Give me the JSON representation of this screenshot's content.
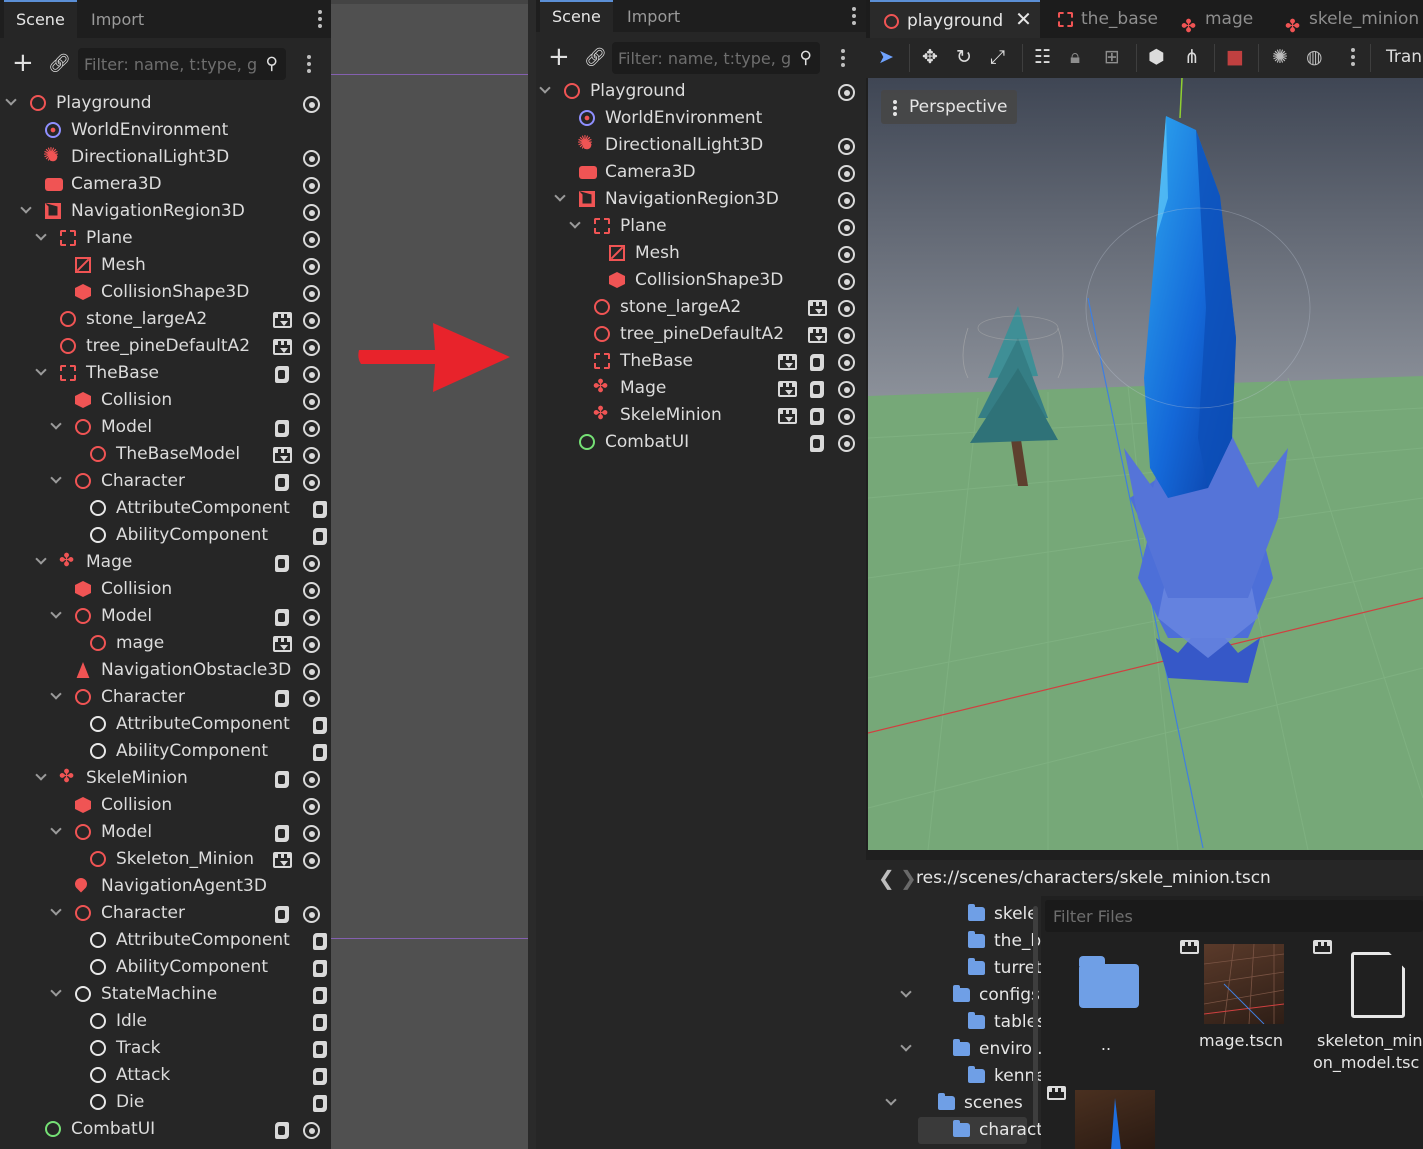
{
  "left_dock": {
    "tabs": [
      "Scene",
      "Import"
    ],
    "filter_placeholder": "Filter: name, t:type, g:",
    "tree": [
      {
        "label": "Playground",
        "icon": "node3d-icon",
        "depth": 0,
        "expanded": true,
        "badges": [
          "eye"
        ]
      },
      {
        "label": "WorldEnvironment",
        "icon": "world-environment-icon",
        "depth": 1,
        "badges": []
      },
      {
        "label": "DirectionalLight3D",
        "icon": "directional-light-icon",
        "depth": 1,
        "badges": [
          "eye"
        ]
      },
      {
        "label": "Camera3D",
        "icon": "camera-icon",
        "depth": 1,
        "badges": [
          "eye"
        ]
      },
      {
        "label": "NavigationRegion3D",
        "icon": "navigation-region-icon",
        "depth": 1,
        "expanded": true,
        "badges": [
          "eye"
        ]
      },
      {
        "label": "Plane",
        "icon": "static-body-icon",
        "depth": 2,
        "expanded": true,
        "badges": [
          "eye"
        ]
      },
      {
        "label": "Mesh",
        "icon": "mesh-icon",
        "depth": 3,
        "badges": [
          "eye"
        ]
      },
      {
        "label": "CollisionShape3D",
        "icon": "collision-shape-icon",
        "depth": 3,
        "badges": [
          "eye"
        ]
      },
      {
        "label": "stone_largeA2",
        "icon": "node3d-icon",
        "depth": 2,
        "badges": [
          "scene",
          "eye"
        ]
      },
      {
        "label": "tree_pineDefaultA2",
        "icon": "node3d-icon",
        "depth": 2,
        "badges": [
          "scene",
          "eye"
        ]
      },
      {
        "label": "TheBase",
        "icon": "static-body-icon",
        "depth": 2,
        "expanded": true,
        "badges": [
          "script",
          "eye"
        ]
      },
      {
        "label": "Collision",
        "icon": "collision-shape-icon",
        "depth": 3,
        "badges": [
          "eye"
        ]
      },
      {
        "label": "Model",
        "icon": "node3d-icon",
        "depth": 3,
        "expanded": true,
        "badges": [
          "script",
          "eye"
        ]
      },
      {
        "label": "TheBaseModel",
        "icon": "node3d-icon",
        "depth": 4,
        "badges": [
          "scene",
          "eye"
        ]
      },
      {
        "label": "Character",
        "icon": "node3d-icon",
        "depth": 3,
        "expanded": true,
        "badges": [
          "script",
          "eye"
        ]
      },
      {
        "label": "AttributeComponent",
        "icon": "node-icon",
        "depth": 4,
        "badges": [
          "script"
        ]
      },
      {
        "label": "AbilityComponent",
        "icon": "node-icon",
        "depth": 4,
        "badges": [
          "script"
        ]
      },
      {
        "label": "Mage",
        "icon": "character-body-icon",
        "depth": 2,
        "expanded": true,
        "badges": [
          "script",
          "eye"
        ]
      },
      {
        "label": "Collision",
        "icon": "collision-shape-icon",
        "depth": 3,
        "badges": [
          "eye"
        ]
      },
      {
        "label": "Model",
        "icon": "node3d-icon",
        "depth": 3,
        "expanded": true,
        "badges": [
          "script",
          "eye"
        ]
      },
      {
        "label": "mage",
        "icon": "node3d-icon",
        "depth": 4,
        "badges": [
          "scene",
          "eye"
        ]
      },
      {
        "label": "NavigationObstacle3D",
        "icon": "navigation-obstacle-icon",
        "depth": 3,
        "badges": [
          "eye"
        ]
      },
      {
        "label": "Character",
        "icon": "node3d-icon",
        "depth": 3,
        "expanded": true,
        "badges": [
          "script",
          "eye"
        ]
      },
      {
        "label": "AttributeComponent",
        "icon": "node-icon",
        "depth": 4,
        "badges": [
          "script"
        ]
      },
      {
        "label": "AbilityComponent",
        "icon": "node-icon",
        "depth": 4,
        "badges": [
          "script"
        ]
      },
      {
        "label": "SkeleMinion",
        "icon": "character-body-icon",
        "depth": 2,
        "expanded": true,
        "badges": [
          "script",
          "eye"
        ]
      },
      {
        "label": "Collision",
        "icon": "collision-shape-icon",
        "depth": 3,
        "badges": [
          "eye"
        ]
      },
      {
        "label": "Model",
        "icon": "node3d-icon",
        "depth": 3,
        "expanded": true,
        "badges": [
          "script",
          "eye"
        ]
      },
      {
        "label": "Skeleton_Minion",
        "icon": "node3d-icon",
        "depth": 4,
        "badges": [
          "scene",
          "eye"
        ]
      },
      {
        "label": "NavigationAgent3D",
        "icon": "navigation-agent-icon",
        "depth": 3,
        "badges": []
      },
      {
        "label": "Character",
        "icon": "node3d-icon",
        "depth": 3,
        "expanded": true,
        "badges": [
          "script",
          "eye"
        ]
      },
      {
        "label": "AttributeComponent",
        "icon": "node-icon",
        "depth": 4,
        "badges": [
          "script"
        ]
      },
      {
        "label": "AbilityComponent",
        "icon": "node-icon",
        "depth": 4,
        "badges": [
          "script"
        ]
      },
      {
        "label": "StateMachine",
        "icon": "node-icon",
        "depth": 3,
        "expanded": true,
        "badges": [
          "script"
        ]
      },
      {
        "label": "Idle",
        "icon": "node-icon",
        "depth": 4,
        "badges": [
          "script"
        ]
      },
      {
        "label": "Track",
        "icon": "node-icon",
        "depth": 4,
        "badges": [
          "script"
        ]
      },
      {
        "label": "Attack",
        "icon": "node-icon",
        "depth": 4,
        "badges": [
          "script"
        ]
      },
      {
        "label": "Die",
        "icon": "node-icon",
        "depth": 4,
        "badges": [
          "script"
        ]
      },
      {
        "label": "CombatUI",
        "icon": "control-icon",
        "depth": 1,
        "badges": [
          "script",
          "eye"
        ]
      }
    ]
  },
  "mid_dock": {
    "tabs": [
      "Scene",
      "Import"
    ],
    "filter_placeholder": "Filter: name, t:type, g:",
    "tree": [
      {
        "label": "Playground",
        "icon": "node3d-icon",
        "depth": 0,
        "expanded": true,
        "badges": [
          "eye"
        ]
      },
      {
        "label": "WorldEnvironment",
        "icon": "world-environment-icon",
        "depth": 1,
        "badges": []
      },
      {
        "label": "DirectionalLight3D",
        "icon": "directional-light-icon",
        "depth": 1,
        "badges": [
          "eye"
        ]
      },
      {
        "label": "Camera3D",
        "icon": "camera-icon",
        "depth": 1,
        "badges": [
          "eye"
        ]
      },
      {
        "label": "NavigationRegion3D",
        "icon": "navigation-region-icon",
        "depth": 1,
        "expanded": true,
        "badges": [
          "eye"
        ]
      },
      {
        "label": "Plane",
        "icon": "static-body-icon",
        "depth": 2,
        "expanded": true,
        "badges": [
          "eye"
        ]
      },
      {
        "label": "Mesh",
        "icon": "mesh-icon",
        "depth": 3,
        "badges": [
          "eye"
        ]
      },
      {
        "label": "CollisionShape3D",
        "icon": "collision-shape-icon",
        "depth": 3,
        "badges": [
          "eye"
        ]
      },
      {
        "label": "stone_largeA2",
        "icon": "node3d-icon",
        "depth": 2,
        "badges": [
          "scene",
          "eye"
        ]
      },
      {
        "label": "tree_pineDefaultA2",
        "icon": "node3d-icon",
        "depth": 2,
        "badges": [
          "scene",
          "eye"
        ]
      },
      {
        "label": "TheBase",
        "icon": "static-body-icon",
        "depth": 2,
        "badges": [
          "scene",
          "script",
          "eye"
        ]
      },
      {
        "label": "Mage",
        "icon": "character-body-icon",
        "depth": 2,
        "badges": [
          "scene",
          "script",
          "eye"
        ]
      },
      {
        "label": "SkeleMinion",
        "icon": "character-body-icon",
        "depth": 2,
        "badges": [
          "scene",
          "script",
          "eye"
        ]
      },
      {
        "label": "CombatUI",
        "icon": "control-icon",
        "depth": 1,
        "badges": [
          "script",
          "eye"
        ]
      }
    ]
  },
  "editor_tabs": [
    {
      "label": "playground",
      "icon": "node3d-icon",
      "active": true
    },
    {
      "label": "the_base",
      "icon": "static-body-icon"
    },
    {
      "label": "mage",
      "icon": "character-body-icon"
    },
    {
      "label": "skele_minion",
      "icon": "character-body-icon"
    }
  ],
  "viewport": {
    "toolbar_trailing_label": "Tran",
    "perspective_label": "Perspective"
  },
  "filesystem": {
    "path": "res://scenes/characters/skele_minion.tscn",
    "filter_placeholder": "Filter Files",
    "tree": [
      {
        "label": "skele",
        "depth": 2
      },
      {
        "label": "the_b",
        "depth": 2
      },
      {
        "label": "turrets",
        "depth": 2
      },
      {
        "label": "configs",
        "depth": 1,
        "expanded": true
      },
      {
        "label": "tables",
        "depth": 2
      },
      {
        "label": "enviro...",
        "depth": 1,
        "expanded": true
      },
      {
        "label": "kenne",
        "depth": 2
      },
      {
        "label": "scenes",
        "depth": 0,
        "expanded": true
      },
      {
        "label": "charact...",
        "depth": 1,
        "selected": true
      }
    ],
    "items": [
      {
        "label": "..",
        "kind": "folder"
      },
      {
        "label": "mage.tscn",
        "kind": "scene-thumb"
      },
      {
        "label": "skeleton_min",
        "label2": "on_model.tsc",
        "kind": "document"
      }
    ]
  },
  "colors": {
    "accent": "#5b8fd6",
    "node3d": "#f05454",
    "control": "#75e075",
    "folder": "#6f9fe6",
    "arrow": "#e8232b"
  }
}
